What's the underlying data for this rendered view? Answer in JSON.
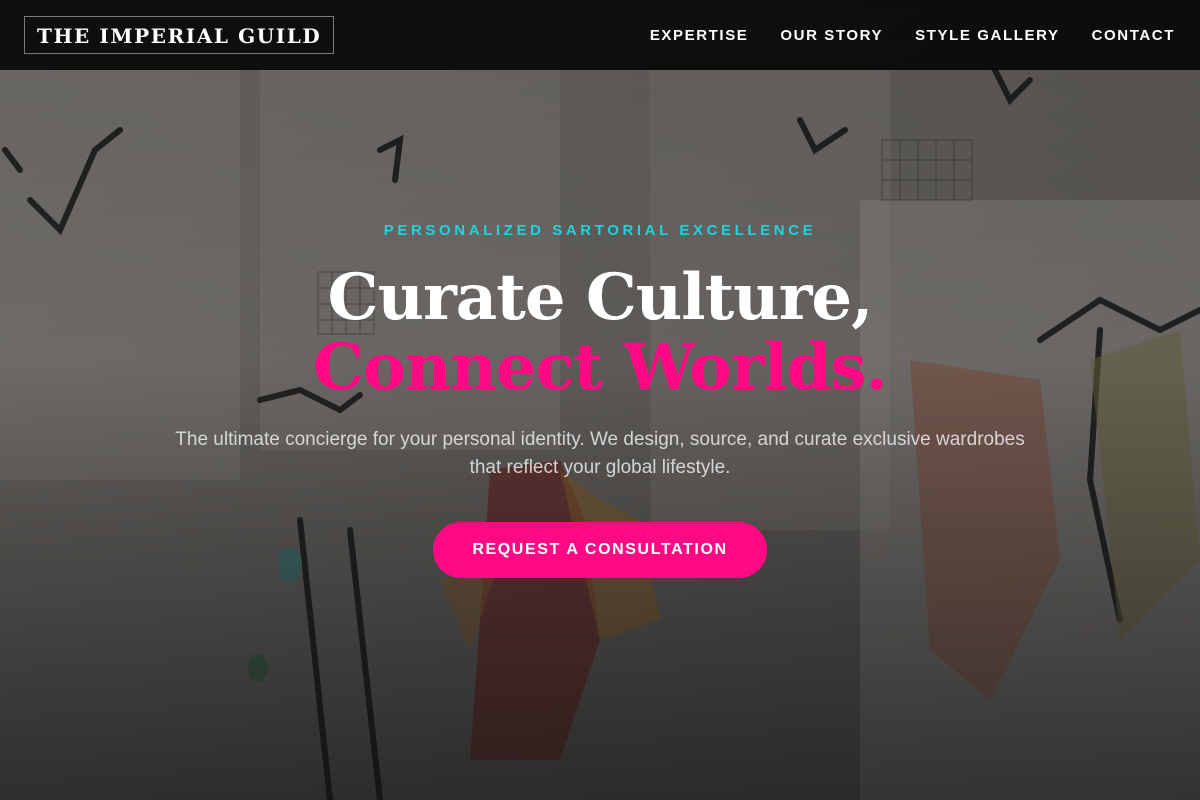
{
  "header": {
    "logo_text": "THE IMPERIAL GUILD",
    "nav": [
      "EXPERTISE",
      "OUR STORY",
      "STYLE GALLERY",
      "CONTACT"
    ]
  },
  "hero": {
    "eyebrow": "PERSONALIZED SARTORIAL EXCELLENCE",
    "headline_line1": "Curate Culture,",
    "headline_line2": "Connect Worlds.",
    "subtext": "The ultimate concierge for your personal identity. We design, source, and curate exclusive wardrobes that reflect your global lifestyle.",
    "cta_label": "REQUEST A CONSULTATION",
    "background_image": "fashion-sketches-on-wall"
  },
  "colors": {
    "accent_pink": "#ff0a84",
    "accent_cyan": "#1ed3dc",
    "header_bg": "#080808"
  }
}
